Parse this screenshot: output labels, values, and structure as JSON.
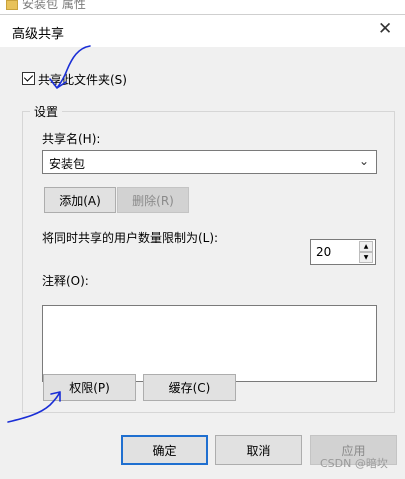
{
  "background_window": {
    "title": "安装包 属性"
  },
  "dialog": {
    "title": "高级共享",
    "close_glyph": "✕",
    "share_checkbox": {
      "label": "共享此文件夹(S)",
      "checked": true
    },
    "settings": {
      "group_title": "设置",
      "share_name_label": "共享名(H):",
      "share_name_value": "安装包",
      "add_label": "添加(A)",
      "remove_label": "删除(R)",
      "limit_label": "将同时共享的用户数量限制为(L):",
      "limit_value": "20",
      "comment_label": "注释(O):",
      "comment_value": "",
      "permissions_label": "权限(P)",
      "cache_label": "缓存(C)"
    },
    "footer": {
      "ok_label": "确定",
      "cancel_label": "取消",
      "apply_label": "应用"
    }
  },
  "watermark": "CSDN @暗坎",
  "colors": {
    "annotation_ink": "#1a2ed6",
    "default_button_border": "#1f6fd0"
  }
}
